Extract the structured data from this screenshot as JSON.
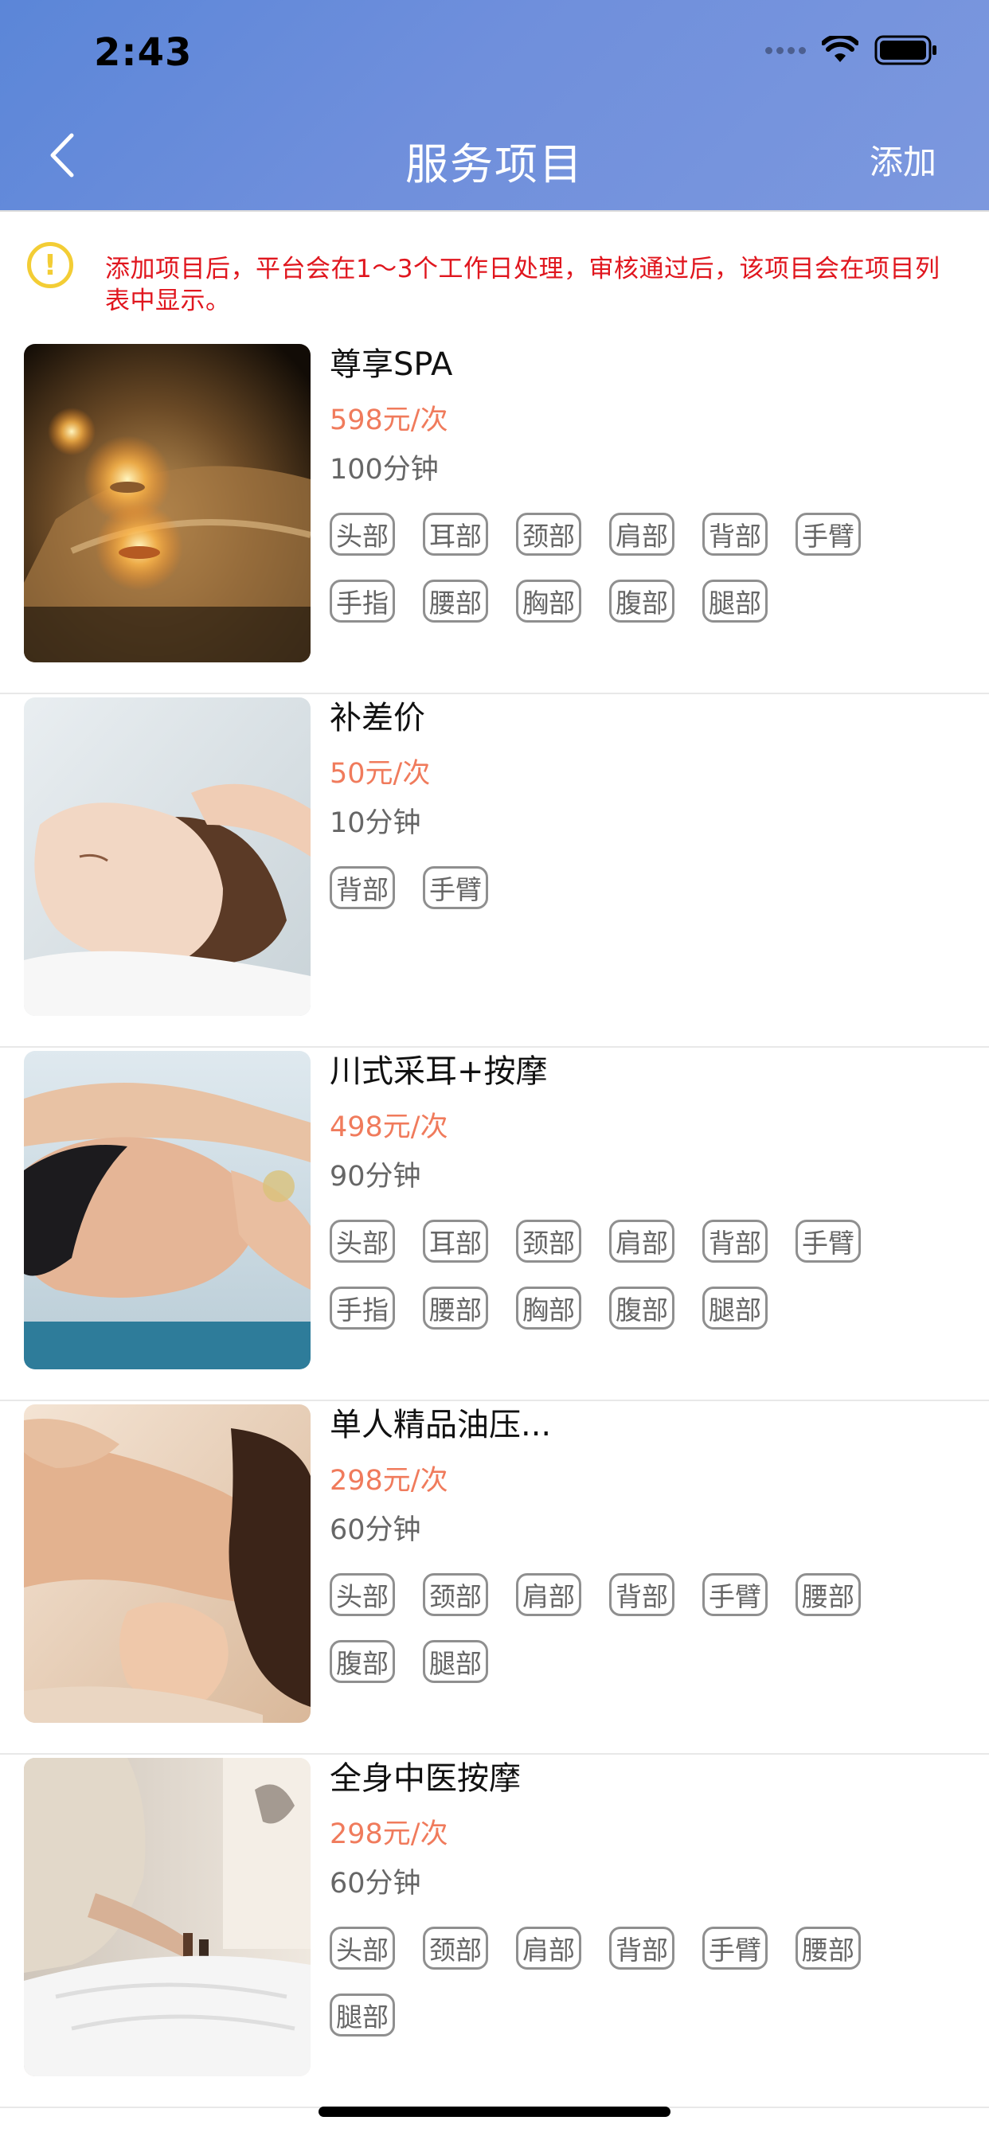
{
  "status_bar": {
    "time": "2:43"
  },
  "nav": {
    "title": "服务项目",
    "add_label": "添加"
  },
  "notice": {
    "text": "添加项目后，平台会在1～3个工作日处理，审核通过后，该项目会在项目列表中显示。"
  },
  "items": [
    {
      "name": "尊享SPA",
      "price": "598元/次",
      "duration": "100分钟",
      "tags": [
        "头部",
        "耳部",
        "颈部",
        "肩部",
        "背部",
        "手臂",
        "手指",
        "腰部",
        "胸部",
        "腹部",
        "腿部"
      ]
    },
    {
      "name": "补差价",
      "price": "50元/次",
      "duration": "10分钟",
      "tags": [
        "背部",
        "手臂"
      ]
    },
    {
      "name": "川式采耳+按摩",
      "price": "498元/次",
      "duration": "90分钟",
      "tags": [
        "头部",
        "耳部",
        "颈部",
        "肩部",
        "背部",
        "手臂",
        "手指",
        "腰部",
        "胸部",
        "腹部",
        "腿部"
      ]
    },
    {
      "name": "单人精品油压...",
      "price": "298元/次",
      "duration": "60分钟",
      "tags": [
        "头部",
        "颈部",
        "肩部",
        "背部",
        "手臂",
        "腰部",
        "腹部",
        "腿部"
      ]
    },
    {
      "name": "全身中医按摩",
      "price": "298元/次",
      "duration": "60分钟",
      "tags": [
        "头部",
        "颈部",
        "肩部",
        "背部",
        "手臂",
        "腰部",
        "腿部"
      ]
    }
  ],
  "colors": {
    "header_blue": "#6a8edb",
    "price": "#f07b5c",
    "notice_text": "#e0161e",
    "notice_icon": "#f3cd35"
  }
}
